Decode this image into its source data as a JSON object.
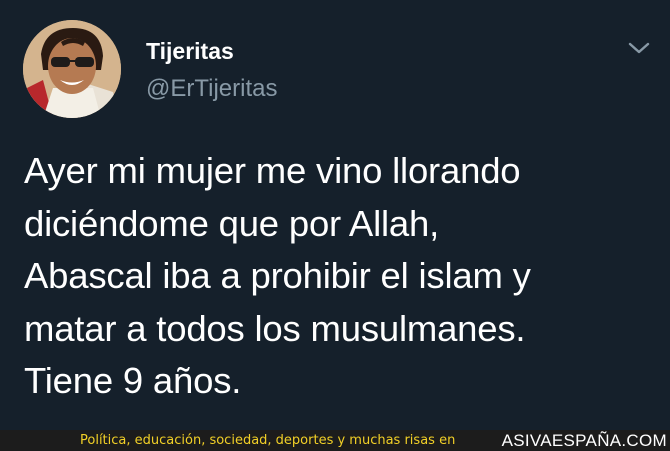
{
  "tweet": {
    "display_name": "Tijeritas",
    "handle": "@ErTijeritas",
    "text_lines": [
      "Ayer mi mujer me vino llorando",
      "diciéndome que por Allah,",
      "Abascal iba a prohibir el islam y",
      "matar a todos los musulmanes.",
      "Tiene 9 años."
    ],
    "menu_icon": "chevron-down-icon"
  },
  "footer": {
    "slogan": "Política, educación, sociedad, deportes y muchas risas en",
    "brand": "ASIVAESPAÑA.COM"
  },
  "colors": {
    "background": "#15202b",
    "text": "#ffffff",
    "secondary_text": "#8899a6",
    "footer_background": "#1c1c1c",
    "footer_slogan": "#f2d027"
  }
}
